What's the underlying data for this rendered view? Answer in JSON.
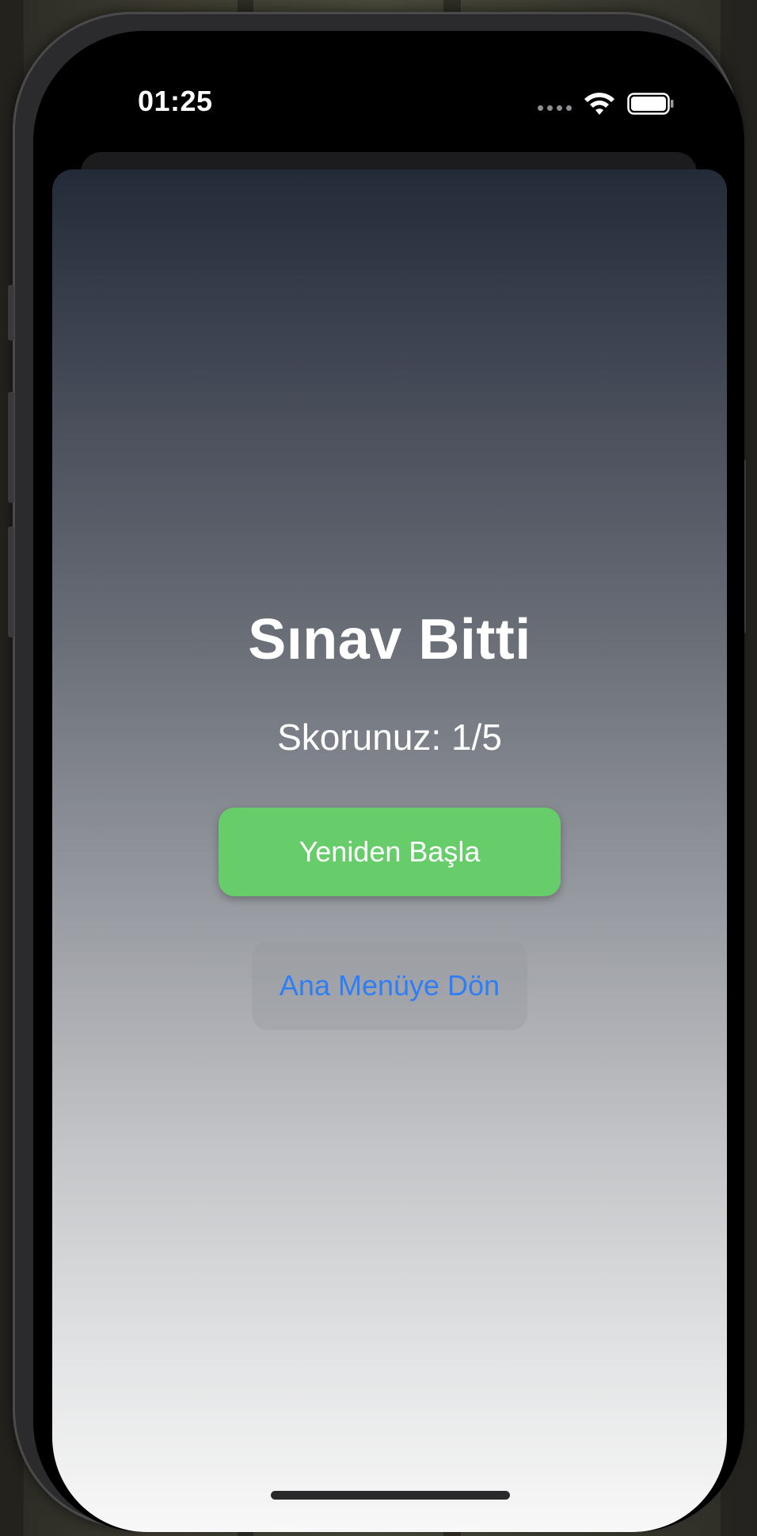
{
  "status_bar": {
    "time": "01:25",
    "wifi_icon": "wifi-icon",
    "battery_icon": "battery-icon",
    "signal_icon": "signal-dots-icon"
  },
  "result": {
    "title": "Sınav Bitti",
    "score_text": "Skorunuz: 1/5"
  },
  "actions": {
    "restart_label": "Yeniden Başla",
    "menu_label": "Ana Menüye Dön"
  },
  "colors": {
    "restart_button": "#66cd6a",
    "menu_text": "#2f7ef6"
  }
}
